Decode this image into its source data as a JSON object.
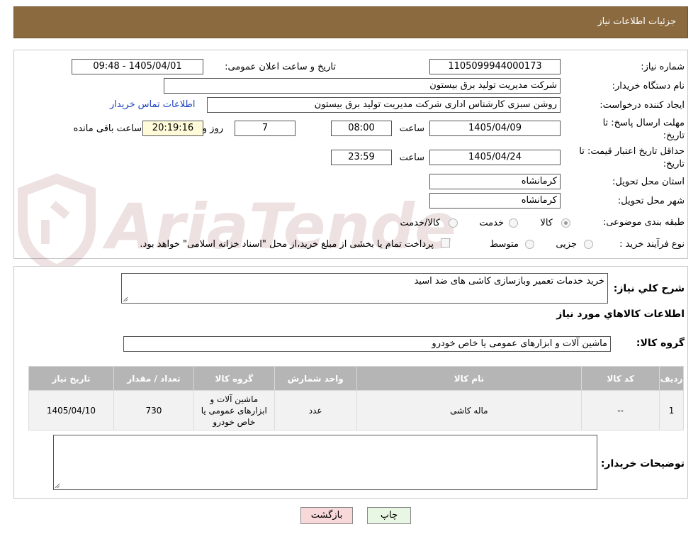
{
  "header": {
    "title": "جزئیات اطلاعات نیاز"
  },
  "form": {
    "need_number_label": "شماره نیاز:",
    "need_number": "1105099944000173",
    "announce_label": "تاریخ و ساعت اعلان عمومی:",
    "announce_value": "1405/04/01 - 09:48",
    "buyer_org_label": "نام دستگاه خریدار:",
    "buyer_org": "شرکت مدیریت تولید برق بیستون",
    "requester_label": "ایجاد کننده درخواست:",
    "requester": "روشن سبزی کارشناس اداری شرکت مدیریت تولید برق بیستون",
    "contact_link": "اطلاعات تماس خریدار",
    "deadline_label_1": "مهلت ارسال پاسخ: تا",
    "deadline_label_2": "تاریخ:",
    "deadline_date": "1405/04/09",
    "time_label": "ساعت",
    "deadline_time": "08:00",
    "days_value": "7",
    "days_label": "روز و",
    "remaining_time": "20:19:16",
    "remaining_label": "ساعت باقی مانده",
    "validity_label_1": "حداقل تاریخ اعتبار قیمت: تا",
    "validity_label_2": "تاریخ:",
    "validity_date": "1405/04/24",
    "validity_time": "23:59",
    "province_label": "استان محل تحویل:",
    "province": "کرمانشاه",
    "city_label": "شهر محل تحویل:",
    "city": "کرمانشاه",
    "category_label": "طبقه بندی موضوعی:",
    "category_options": [
      "کالا",
      "خدمت",
      "کالا/خدمت"
    ],
    "process_label": "نوع فرآیند خرید :",
    "process_options": [
      "جزیی",
      "متوسط"
    ],
    "payment_note": "پرداخت تمام یا بخشی از مبلغ خرید،از محل \"اسناد خزانه اسلامی\" خواهد بود."
  },
  "details": {
    "summary_label": "شرح کلي نياز:",
    "summary": "خرید خدمات تعمیر وبازسازی کاشی های ضد اسید",
    "goods_info_title": "اطلاعات کالاهاي مورد نياز",
    "goods_group_label": "گروه کالا:",
    "goods_group": "ماشین آلات و ابزارهای عمومی یا خاص خودرو",
    "table": {
      "headers": [
        "ردیف",
        "کد کالا",
        "نام کالا",
        "واحد شمارش",
        "گروه کالا",
        "تعداد / مقدار",
        "تاریخ نیاز"
      ],
      "rows": [
        [
          "1",
          "--",
          "ماله کاشی",
          "عدد",
          "ماشین آلات و ابزارهای عمومی یا خاص خودرو",
          "730",
          "1405/04/10"
        ]
      ]
    },
    "buyer_notes_label": "توضیحات خریدار:",
    "buyer_notes": ""
  },
  "buttons": {
    "back": "بازگشت",
    "print": "چاپ"
  },
  "watermark": {
    "text": "AriaTender.neT"
  }
}
